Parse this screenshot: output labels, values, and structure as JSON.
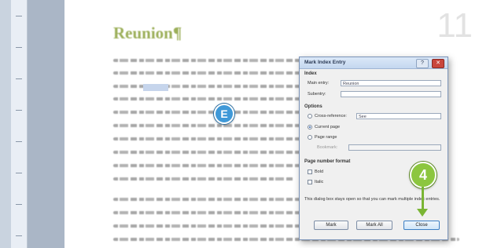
{
  "document": {
    "heading": "Reunion¶",
    "page_number": "11"
  },
  "dialog": {
    "title": "Mark Index Entry",
    "help_icon": "?",
    "close_icon": "✕",
    "index_section": "Index",
    "main_entry_label": "Main entry:",
    "main_entry_value": "Reunion",
    "subentry_label": "Subentry:",
    "subentry_value": "",
    "options_section": "Options",
    "cross_reference_label": "Cross-reference:",
    "cross_reference_value": "See",
    "current_page_label": "Current page",
    "page_range_label": "Page range",
    "bookmark_label": "Bookmark:",
    "page_format_section": "Page number format",
    "bold_label": "Bold",
    "italic_label": "Italic",
    "info_text": "This dialog box stays open so that you can mark multiple index entries.",
    "mark_button": "Mark",
    "mark_all_button": "Mark All",
    "close_button": "Close"
  },
  "callouts": {
    "step_e": "E",
    "step_4": "4"
  },
  "colors": {
    "heading": "#9caf5a",
    "callout_blue": "#3f99d8",
    "callout_green": "#8cc63f"
  }
}
